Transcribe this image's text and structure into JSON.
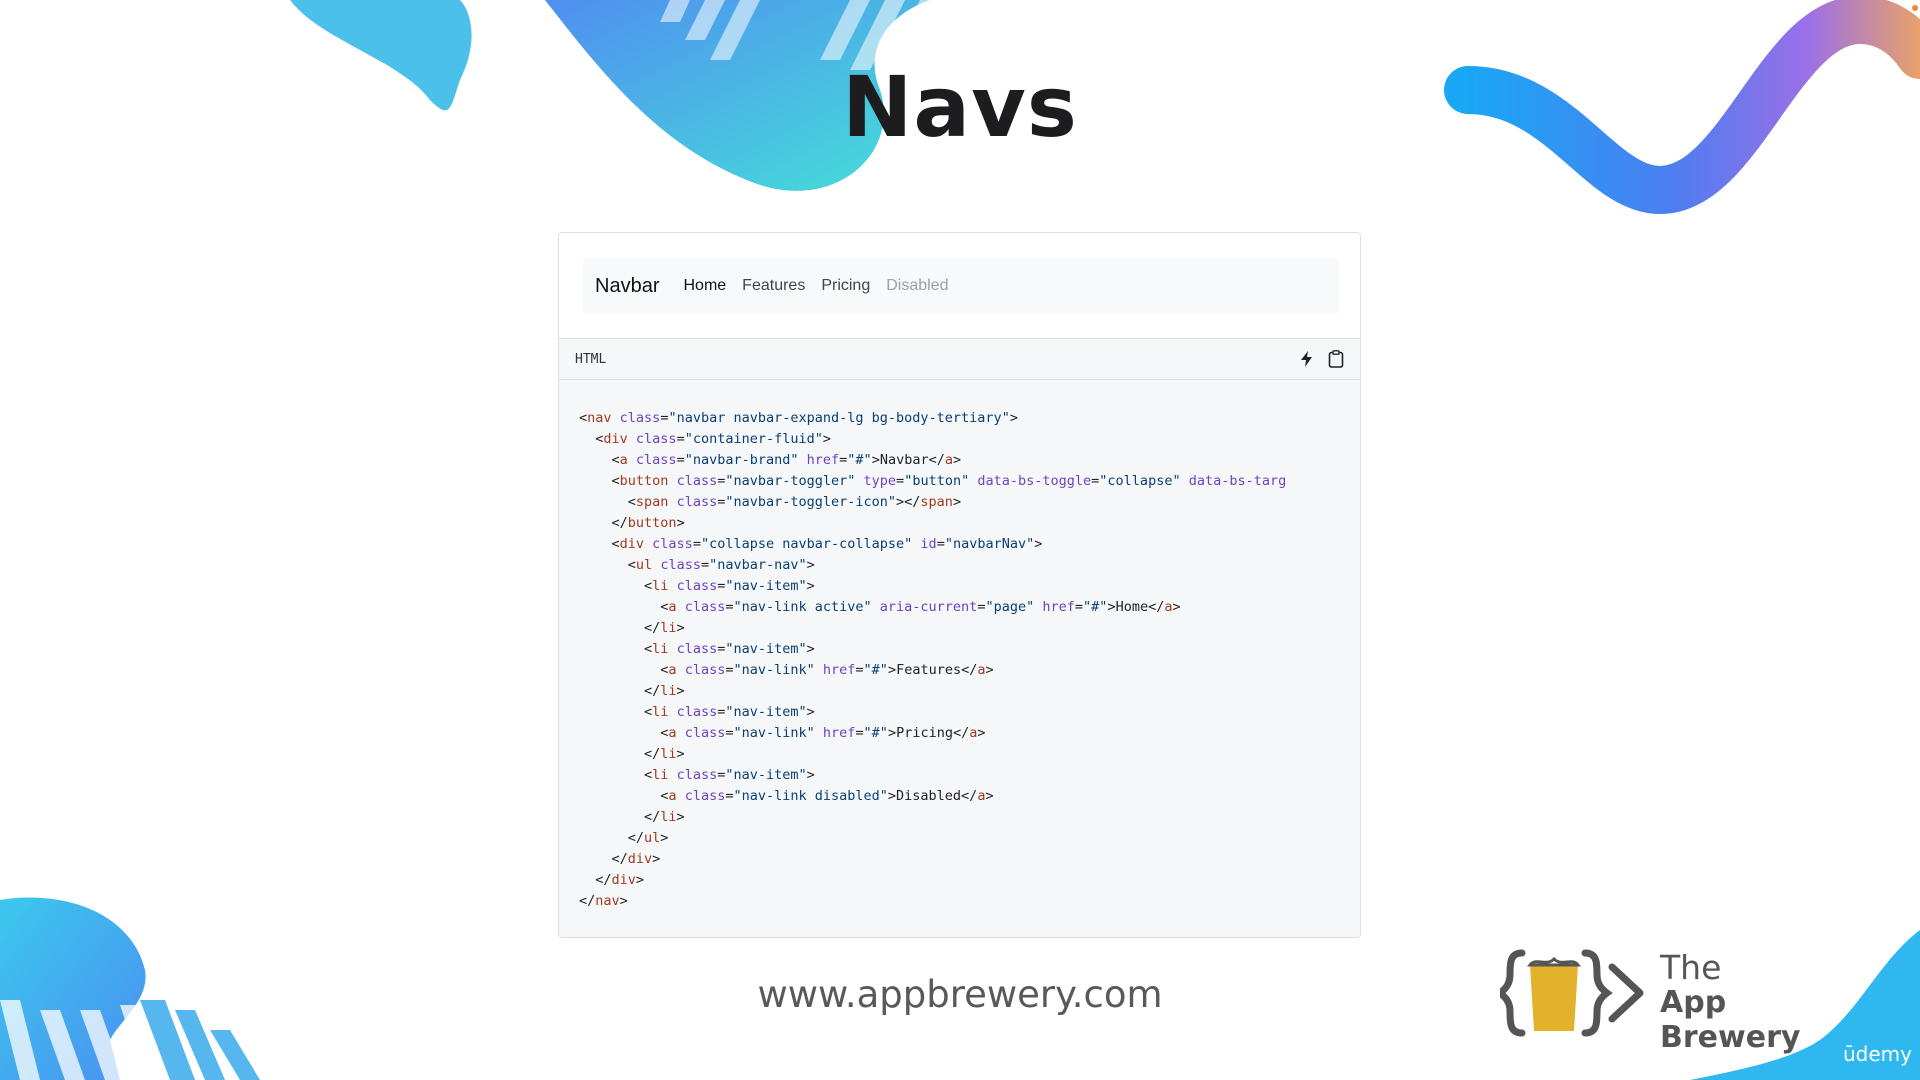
{
  "slide": {
    "title": "Navs",
    "url": "www.appbrewery.com"
  },
  "preview": {
    "brand": "Navbar",
    "links": [
      {
        "label": "Home",
        "state": "active"
      },
      {
        "label": "Features",
        "state": "normal"
      },
      {
        "label": "Pricing",
        "state": "normal"
      },
      {
        "label": "Disabled",
        "state": "disabled"
      }
    ]
  },
  "code": {
    "language": "HTML",
    "icons": [
      "lightning-icon",
      "clipboard-icon"
    ],
    "lines": [
      "<nav class=\"navbar navbar-expand-lg bg-body-tertiary\">",
      "  <div class=\"container-fluid\">",
      "    <a class=\"navbar-brand\" href=\"#\">Navbar</a>",
      "    <button class=\"navbar-toggler\" type=\"button\" data-bs-toggle=\"collapse\" data-bs-targ",
      "      <span class=\"navbar-toggler-icon\"></span>",
      "    </button>",
      "    <div class=\"collapse navbar-collapse\" id=\"navbarNav\">",
      "      <ul class=\"navbar-nav\">",
      "        <li class=\"nav-item\">",
      "          <a class=\"nav-link active\" aria-current=\"page\" href=\"#\">Home</a>",
      "        </li>",
      "        <li class=\"nav-item\">",
      "          <a class=\"nav-link\" href=\"#\">Features</a>",
      "        </li>",
      "        <li class=\"nav-item\">",
      "          <a class=\"nav-link\" href=\"#\">Pricing</a>",
      "        </li>",
      "        <li class=\"nav-item\">",
      "          <a class=\"nav-link disabled\">Disabled</a>",
      "        </li>",
      "      </ul>",
      "    </div>",
      "  </div>",
      "</nav>"
    ]
  },
  "branding": {
    "logo_line1": "The",
    "logo_line2": "App Brewery",
    "udemy": "ūdemy"
  },
  "colors": {
    "tag": "#a03a1e",
    "attribute": "#6f42c1",
    "string": "#0b3e73",
    "logo_gold": "#e2b22c",
    "logo_gray": "#555555"
  }
}
